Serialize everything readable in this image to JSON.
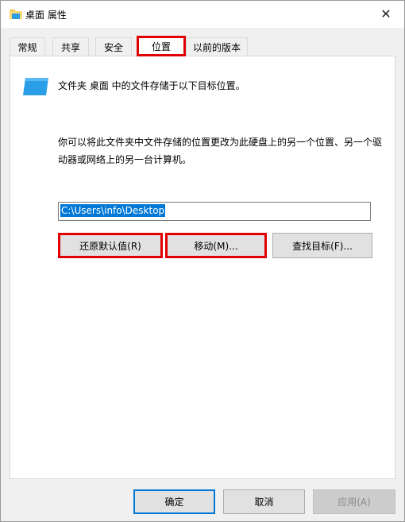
{
  "window": {
    "title": "桌面 属性",
    "close_glyph": "✕"
  },
  "tabs": [
    {
      "label": "常规"
    },
    {
      "label": "共享"
    },
    {
      "label": "安全"
    },
    {
      "label": "位置",
      "active": true
    },
    {
      "label": "以前的版本"
    }
  ],
  "location": {
    "folder_line": "文件夹 桌面 中的文件存储于以下目标位置。",
    "description": "你可以将此文件夹中文件存储的位置更改为此硬盘上的另一个位置、另一个驱动器或网络上的另一台计算机。",
    "path_value": "C:\\Users\\info\\Desktop",
    "restore_button": "还原默认值(R)",
    "move_button": "移动(M)...",
    "find_button": "查找目标(F)..."
  },
  "footer": {
    "ok_button": "确定",
    "cancel_button": "取消",
    "apply_button": "应用(A)"
  },
  "colors": {
    "highlight_red": "#e00000",
    "selection_blue": "#0078d7",
    "folder_blue": "#2a9fe8",
    "folder_yellow": "#f1c24b"
  },
  "icons": {
    "title_icon": "folder-icon",
    "location_icon": "desktop-folder-icon"
  }
}
